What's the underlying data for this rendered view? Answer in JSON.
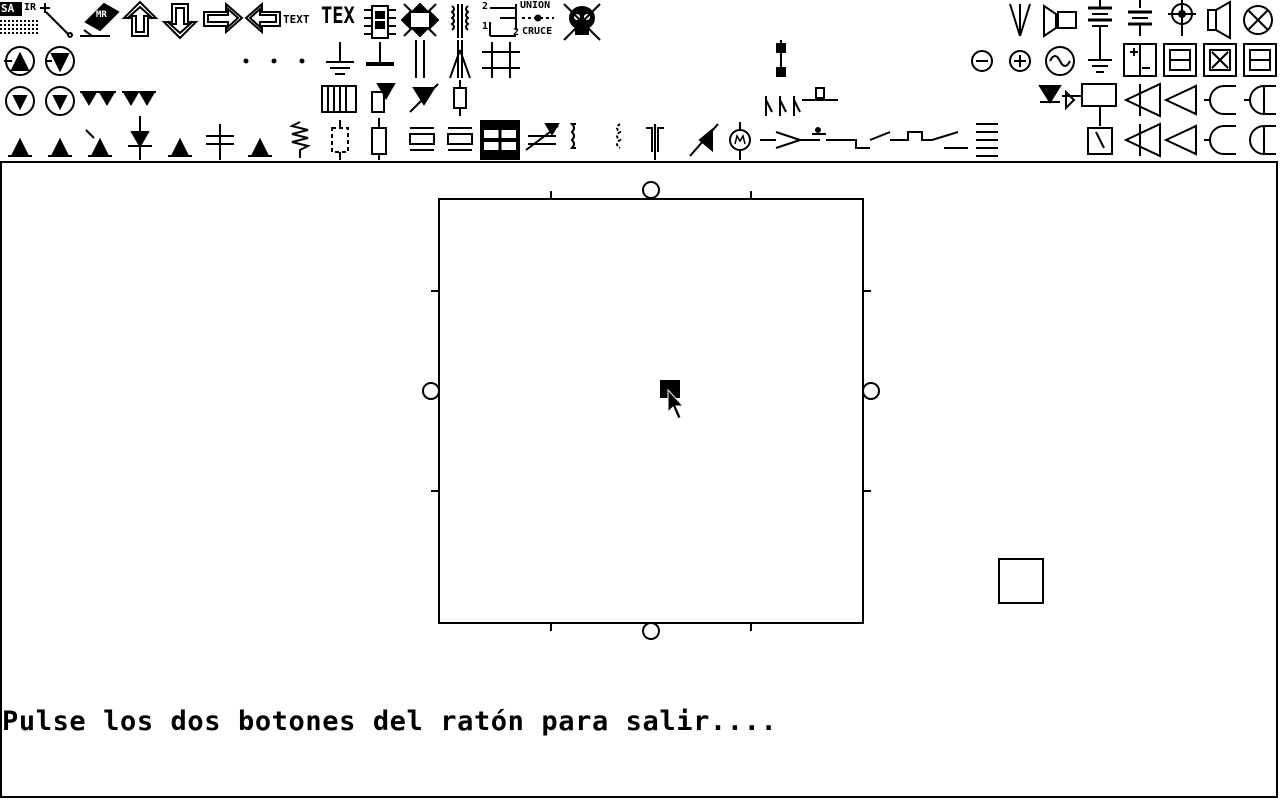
{
  "toolbar": {
    "salir_label": "SA",
    "salir_sub": "IR",
    "texto_label": "TEXT",
    "tex_label": "TEX",
    "mir_label": "MR",
    "union_label": "UNION",
    "cruce_label": "CRUCE",
    "union_num": "2",
    "cruce_num_a": "1",
    "cruce_num_b": "2"
  },
  "status": {
    "message": "Pulse los dos botones del ratón para salir...."
  },
  "icons": [
    "exit-icon",
    "line-icon",
    "eraser-icon",
    "arrow-up-icon",
    "arrow-down-icon",
    "arrow-right-icon",
    "arrow-left-icon",
    "text-icon",
    "tex-icon",
    "chip-icon",
    "move-arrows-icon",
    "transformer-icon",
    "union-cross-icon",
    "skull-icon",
    "transistor-npn-icon",
    "transistor-pnp-icon",
    "diode-icon",
    "zener-icon",
    "capacitor-icon",
    "resistor-icon",
    "inductor-icon",
    "ground-icon",
    "switch-icon",
    "relay-icon",
    "logic-gate-icon",
    "motor-icon",
    "speaker-icon",
    "lamp-icon",
    "antenna-icon",
    "battery-icon",
    "grid-icon"
  ]
}
